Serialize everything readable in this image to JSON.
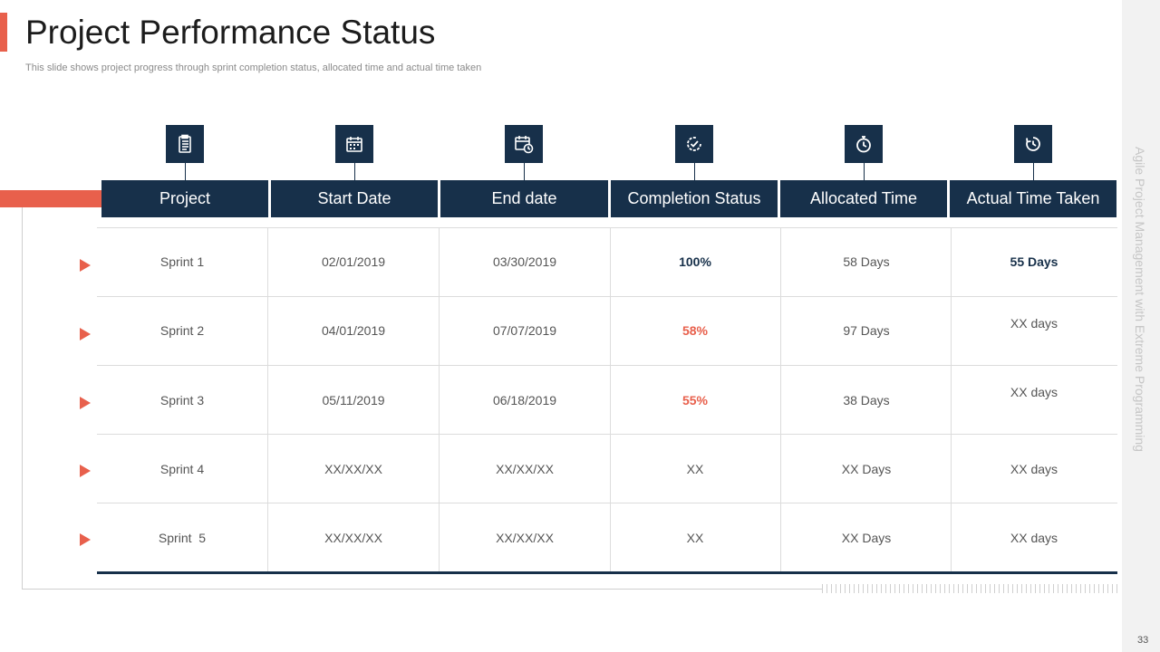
{
  "slide": {
    "title": "Project Performance Status",
    "subtitle": "This slide shows project progress through sprint completion status, allocated time and actual time taken",
    "side_label": "Agile Project Management with Extreme Programming",
    "page_number": "33"
  },
  "colors": {
    "accent": "#e8604c",
    "navy": "#17304a"
  },
  "table": {
    "columns": [
      {
        "label": "Project",
        "icon": "clipboard-list-icon"
      },
      {
        "label": "Start Date",
        "icon": "calendar-icon"
      },
      {
        "label": "End date",
        "icon": "calendar-clock-icon"
      },
      {
        "label": "Completion Status",
        "icon": "check-circle-icon"
      },
      {
        "label": "Allocated Time",
        "icon": "stopwatch-icon"
      },
      {
        "label": "Actual Time Taken",
        "icon": "clock-arrow-icon"
      }
    ],
    "rows": [
      [
        "Sprint 1",
        "02/01/2019",
        "03/30/2019",
        "100%",
        "58 Days",
        "55 Days"
      ],
      [
        "Sprint 2",
        "04/01/2019",
        "07/07/2019",
        "58%",
        "97 Days",
        "XX days"
      ],
      [
        "Sprint 3",
        "05/11/2019",
        "06/18/2019",
        "55%",
        "38 Days",
        "XX days"
      ],
      [
        "Sprint 4",
        "XX/XX/XX",
        "XX/XX/XX",
        "XX",
        "XX Days",
        "XX days"
      ],
      [
        "Sprint  5",
        "XX/XX/XX",
        "XX/XX/XX",
        "XX",
        "XX Days",
        "XX days"
      ]
    ]
  }
}
